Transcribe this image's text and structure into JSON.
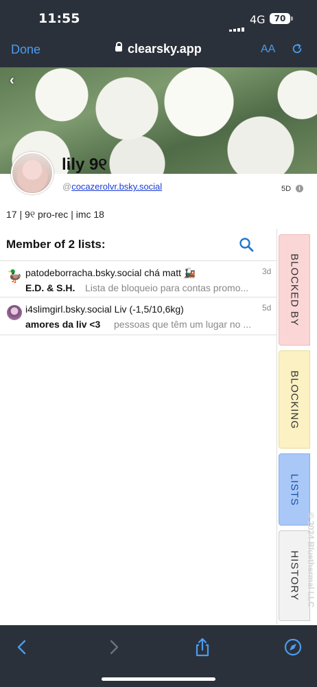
{
  "status_bar": {
    "time": "11:55",
    "network": "4G",
    "battery": "70"
  },
  "browser": {
    "done_label": "Done",
    "url": "clearsky.app",
    "text_size_label": "AA"
  },
  "profile": {
    "display_name": "lily 9୧",
    "handle_prefix": "@",
    "handle": "cocazerolvr.bsky.social",
    "age": "5D",
    "bio": "17 | 9୧ pro-rec | imc 18"
  },
  "lists": {
    "header": "Member of 2 lists:",
    "items": [
      {
        "avatar": "🦆",
        "title": "patodeborracha.bsky.social chá matt 🚂",
        "when": "3d",
        "name": "E.D. & S.H.",
        "description": "Lista de bloqueio para contas promo..."
      },
      {
        "avatar": "",
        "title": "i4slimgirl.bsky.social Liv (-1,5/10,6kg)",
        "when": "5d",
        "name": "amores da liv <3",
        "description": "pessoas que têm um lugar no ..."
      }
    ]
  },
  "side_tabs": [
    {
      "label": "BLOCKED BY",
      "color": "#fbd6d6"
    },
    {
      "label": "BLOCKING",
      "color": "#fbf1c2"
    },
    {
      "label": "LISTS",
      "color": "#a9c8f7"
    },
    {
      "label": "HISTORY",
      "color": "#f2f2f2"
    }
  ],
  "copyright": "© 2024 Bluethermal LLC",
  "colors": {
    "accent": "#4c9cf0",
    "chrome": "#2b313a",
    "link": "#1a3bd6"
  }
}
